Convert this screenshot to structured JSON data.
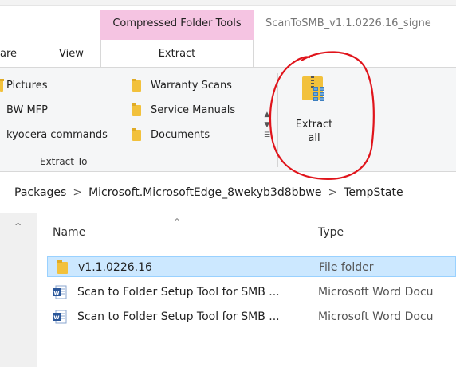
{
  "ribbon": {
    "context_header": "Compressed Folder Tools",
    "window_title": "ScanToSMB_v1.1.0226.16_signe",
    "tabs": [
      {
        "label": "are"
      },
      {
        "label": "View"
      },
      {
        "label": "Extract"
      }
    ],
    "extract_to": {
      "column1": [
        "Pictures",
        "BW MFP",
        "kyocera commands"
      ],
      "column2": [
        "Warranty Scans",
        "Service Manuals",
        "Documents"
      ],
      "group_label": "Extract To"
    },
    "extract_all": {
      "line1": "Extract",
      "line2": "all"
    }
  },
  "address": {
    "crumbs": [
      "Packages",
      "Microsoft.MicrosoftEdge_8wekyb3d8bbwe",
      "TempState"
    ],
    "separator": ">"
  },
  "file_list": {
    "columns": {
      "name": "Name",
      "type": "Type"
    },
    "rows": [
      {
        "name": "v1.1.0226.16",
        "type": "File folder",
        "icon": "folder-icon",
        "selected": true
      },
      {
        "name": "Scan to Folder Setup Tool for SMB ...",
        "type": "Microsoft Word Docu",
        "icon": "word-doc-icon",
        "selected": false
      },
      {
        "name": "Scan to Folder Setup Tool for SMB ...",
        "type": "Microsoft Word Docu",
        "icon": "word-doc-icon",
        "selected": false
      }
    ]
  },
  "colors": {
    "context_tab": "#f5c4e2",
    "selection": "#cce8ff",
    "annotation": "#e0141b",
    "folder": "#f2c13c"
  }
}
